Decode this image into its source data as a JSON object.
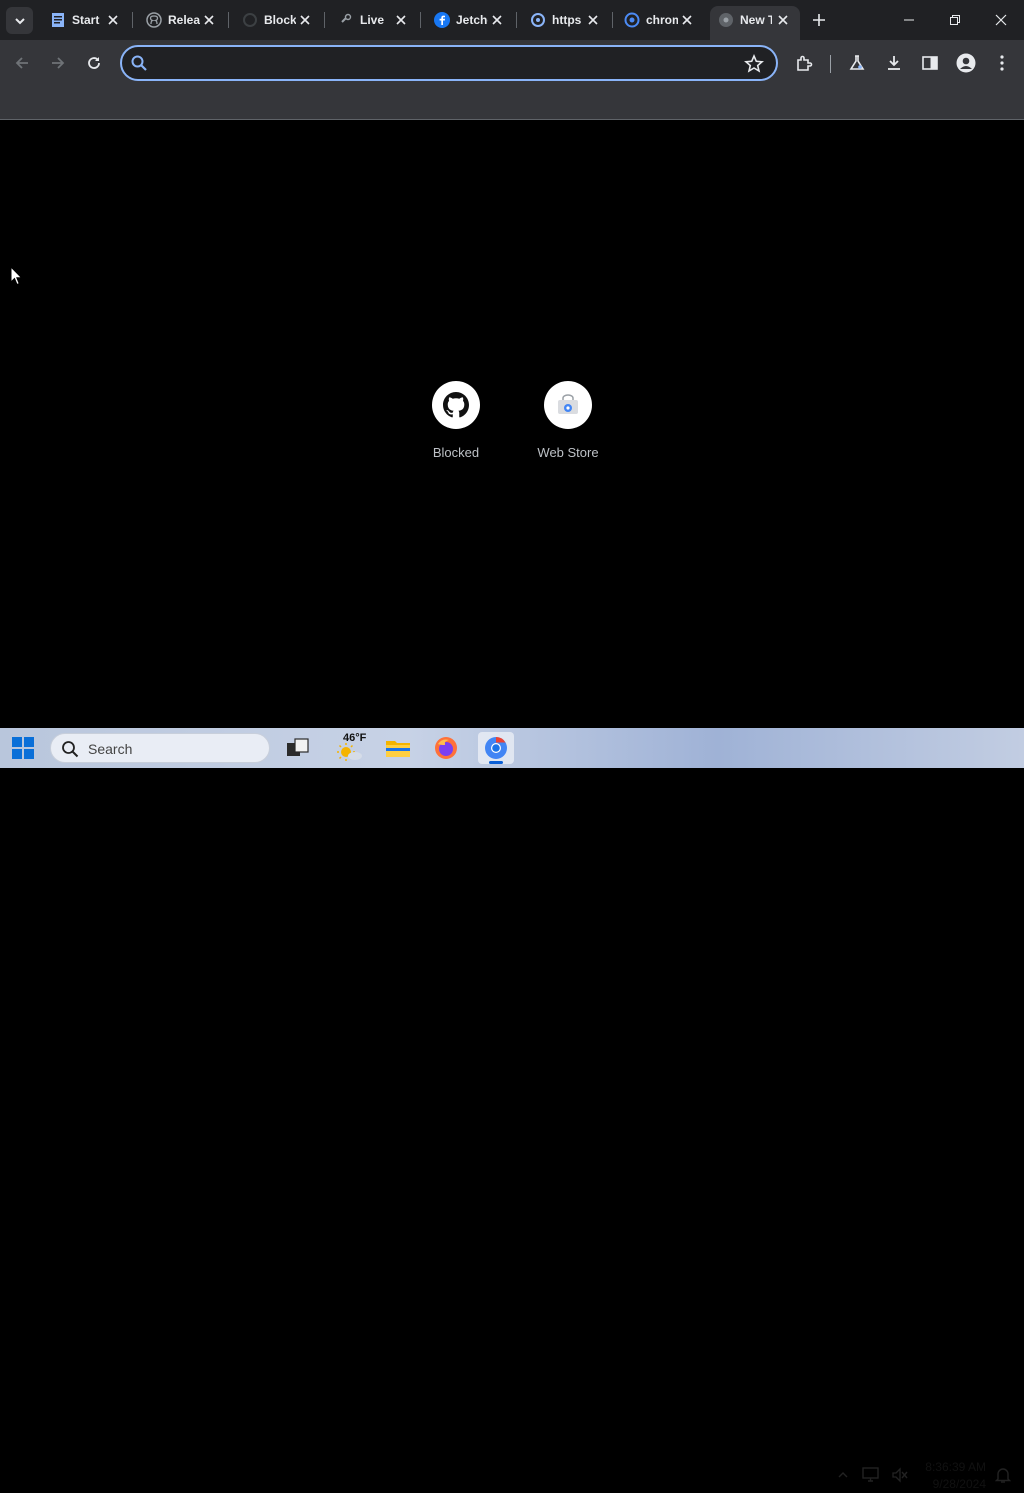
{
  "browser": {
    "tabs": [
      {
        "title": "Start",
        "favicon": "document-icon",
        "active": false
      },
      {
        "title": "Releases",
        "favicon": "github-icon",
        "active": false
      },
      {
        "title": "Blocked",
        "favicon": "loading-icon",
        "active": false
      },
      {
        "title": "Live",
        "favicon": "link-icon",
        "active": false
      },
      {
        "title": "Jetcheck",
        "favicon": "facebook-icon",
        "active": false
      },
      {
        "title": "https",
        "favicon": "chrome-lab-icon",
        "active": false
      },
      {
        "title": "chrome",
        "favicon": "chrome-icon",
        "active": false
      },
      {
        "title": "New Tab",
        "favicon": "chrome-newtab-icon",
        "active": true
      }
    ],
    "omnibox": {
      "value": "",
      "placeholder": ""
    },
    "colors": {
      "accent": "#8ab4f8",
      "tabstrip": "#202124",
      "toolbar": "#35363a"
    }
  },
  "newtab": {
    "shortcuts": [
      {
        "label": "Blocked",
        "icon": "github-icon"
      },
      {
        "label": "Web Store",
        "icon": "web-store-icon"
      }
    ]
  },
  "taskbar": {
    "search_label": "Search",
    "weather_temp": "46°F",
    "clock_time": "8:36:39 AM",
    "clock_date": "9/28/2024"
  }
}
